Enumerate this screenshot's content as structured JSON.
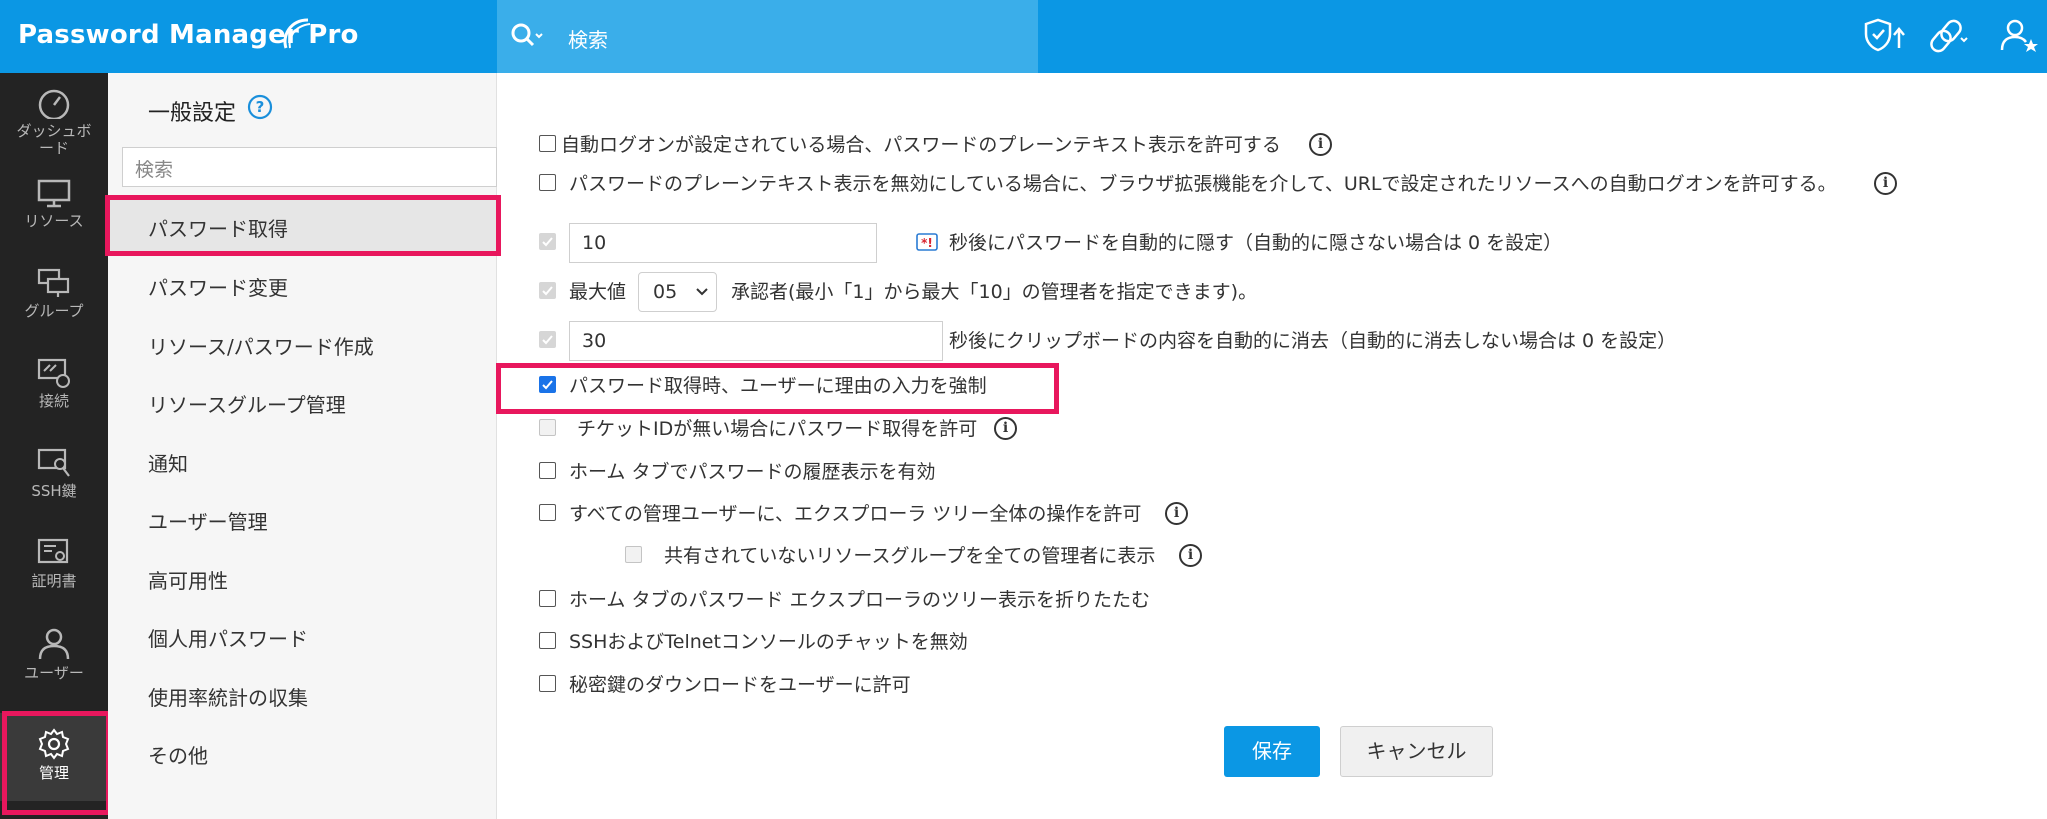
{
  "app": {
    "brand": "Password Manager Pro"
  },
  "search": {
    "placeholder": "検索"
  },
  "rail": {
    "items": [
      {
        "label": "ダッシュボード",
        "icon": "dashboard-icon"
      },
      {
        "label": "リソース",
        "icon": "monitor-icon"
      },
      {
        "label": "グループ",
        "icon": "group-icon"
      },
      {
        "label": "接続",
        "icon": "connection-icon"
      },
      {
        "label": "SSH鍵",
        "icon": "ssh-key-icon"
      },
      {
        "label": "証明書",
        "icon": "certificate-icon"
      },
      {
        "label": "ユーザー",
        "icon": "user-icon"
      },
      {
        "label": "管理",
        "icon": "gear-icon"
      }
    ]
  },
  "menu": {
    "title": "一般設定",
    "search_placeholder": "検索",
    "items": [
      {
        "label": "パスワード取得"
      },
      {
        "label": "パスワード変更"
      },
      {
        "label": "リソース/パスワード作成"
      },
      {
        "label": "リソースグループ管理"
      },
      {
        "label": "通知"
      },
      {
        "label": "ユーザー管理"
      },
      {
        "label": "高可用性"
      },
      {
        "label": "個人用パスワード"
      },
      {
        "label": "使用率統計の収集"
      },
      {
        "label": "その他"
      }
    ]
  },
  "settings": {
    "autologon_plaintext": {
      "label": "自動ログオンが設定されている場合、パスワードのプレーンテキスト表示を許可する",
      "checked": false
    },
    "browser_ext_autologon": {
      "label": "パスワードのプレーンテキスト表示を無効にしている場合に、ブラウザ拡張機能を介して、URLで設定されたリソースへの自動ログオンを許可する。",
      "checked": false
    },
    "auto_hide": {
      "value": "10",
      "label": "秒後にパスワードを自動的に隠す（自動的に隠さない場合は 0 を設定）",
      "checked": true
    },
    "max_approvers": {
      "prefix": "最大値",
      "value": "05",
      "label": "承認者(最小「1」から最大「10」の管理者を指定できます)。",
      "checked": true
    },
    "clipboard_clear": {
      "value": "30",
      "label": "秒後にクリップボードの内容を自動的に消去（自動的に消去しない場合は 0 を設定）",
      "checked": true
    },
    "force_reason": {
      "label": "パスワード取得時、ユーザーに理由の入力を強制",
      "checked": true
    },
    "no_ticket": {
      "label": "チケットIDが無い場合にパスワード取得を許可",
      "checked": false
    },
    "home_history": {
      "label": "ホーム タブでパスワードの履歴表示を有効",
      "checked": false
    },
    "explorer_all": {
      "label": "すべての管理ユーザーに、エクスプローラ ツリー全体の操作を許可",
      "checked": false
    },
    "unshared_groups": {
      "label": "共有されていないリソースグループを全ての管理者に表示",
      "checked": false
    },
    "collapse_tree": {
      "label": "ホーム タブのパスワード エクスプローラのツリー表示を折りたたむ",
      "checked": false
    },
    "ssh_chat": {
      "label": "SSHおよびTelnetコンソールのチャットを無効",
      "checked": false
    },
    "key_download": {
      "label": "秘密鍵のダウンロードをユーザーに許可",
      "checked": false
    }
  },
  "buttons": {
    "save": "保存",
    "cancel": "キャンセル"
  },
  "colors": {
    "topbar": "#0b97e4",
    "highlight": "#e8175d",
    "rail": "#232323"
  }
}
